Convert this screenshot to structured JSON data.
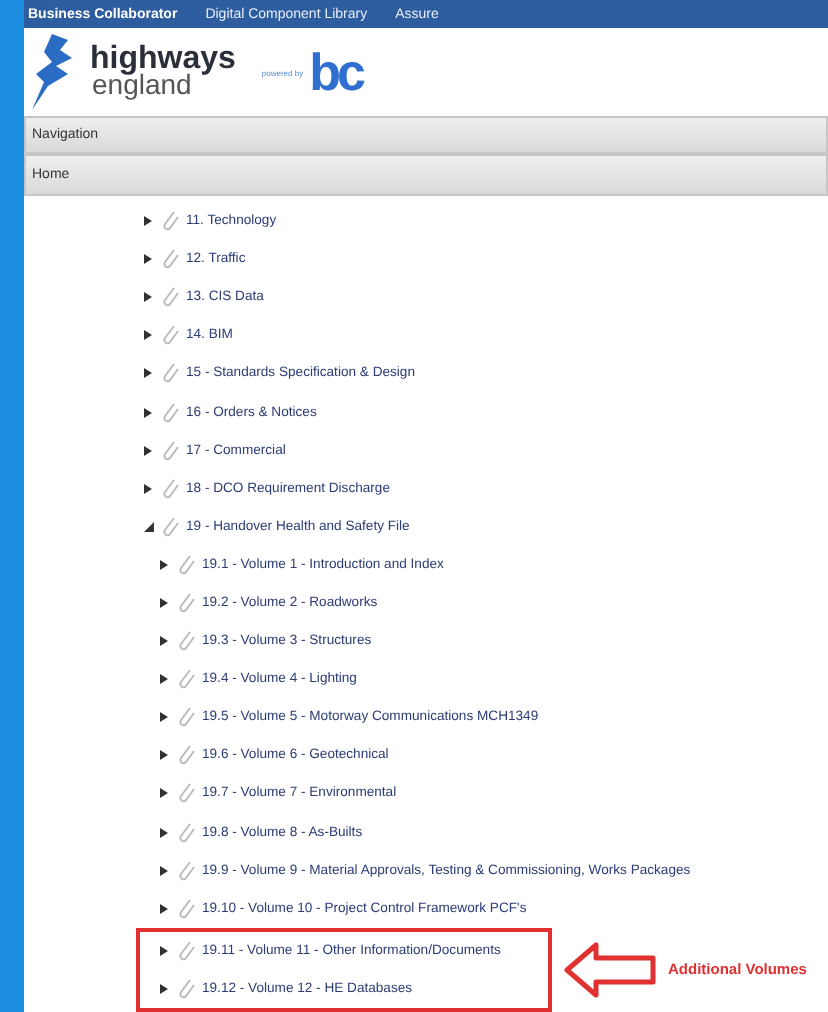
{
  "top_menu": [
    {
      "label": "Business Collaborator",
      "selected": true
    },
    {
      "label": "Digital Component Library",
      "selected": false
    },
    {
      "label": "Assure",
      "selected": false
    }
  ],
  "logo": {
    "line_1": "highways",
    "line_2": "england",
    "powered_by": "powered by",
    "mark": "bc"
  },
  "navigation_bar": {
    "title": "Navigation"
  },
  "breadcrumb": {
    "label": "Home"
  },
  "annotation": {
    "label": "Additional Volumes"
  },
  "tree": [
    {
      "label": "11. Technology",
      "expanded": false
    },
    {
      "label": "12. Traffic",
      "expanded": false
    },
    {
      "label": "13. CIS Data",
      "expanded": false
    },
    {
      "label": "14. BIM",
      "expanded": false
    },
    {
      "label": "15 - Standards Specification & Design",
      "expanded": false
    },
    {
      "label": "16 - Orders & Notices",
      "expanded": false
    },
    {
      "label": "17 - Commercial",
      "expanded": false
    },
    {
      "label": "18 - DCO Requirement Discharge",
      "expanded": false
    },
    {
      "label": "19 - Handover Health and Safety File",
      "expanded": true,
      "children": [
        {
          "label": "19.1 - Volume 1 - Introduction and Index",
          "expanded": false,
          "highlighted": false
        },
        {
          "label": "19.2 - Volume 2 - Roadworks",
          "expanded": false,
          "highlighted": false
        },
        {
          "label": "19.3 - Volume 3 - Structures",
          "expanded": false,
          "highlighted": false
        },
        {
          "label": "19.4 - Volume 4 - Lighting",
          "expanded": false,
          "highlighted": false
        },
        {
          "label": "19.5 - Volume 5 - Motorway Communications MCH1349",
          "expanded": false,
          "highlighted": false
        },
        {
          "label": "19.6 - Volume 6 - Geotechnical",
          "expanded": false,
          "highlighted": false
        },
        {
          "label": "19.7 - Volume 7 - Environmental",
          "expanded": false,
          "highlighted": false
        },
        {
          "label": "19.8 - Volume 8 - As-Builts",
          "expanded": false,
          "highlighted": false
        },
        {
          "label": "19.9 - Volume 9 - Material Approvals, Testing & Commissioning, Works Packages",
          "expanded": false,
          "highlighted": false
        },
        {
          "label": "19.10 - Volume 10 - Project Control Framework PCF's",
          "expanded": false,
          "highlighted": false
        },
        {
          "label": "19.11 - Volume 11 - Other Information/Documents",
          "expanded": false,
          "highlighted": true
        },
        {
          "label": "19.12 - Volume 12 - HE Databases",
          "expanded": false,
          "highlighted": true
        }
      ]
    }
  ]
}
